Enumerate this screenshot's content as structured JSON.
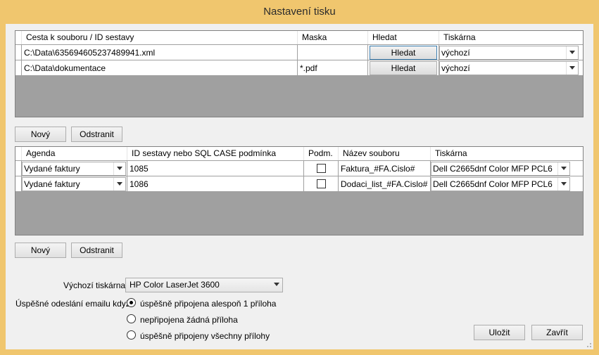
{
  "window": {
    "title": "Nastavení tisku"
  },
  "grid1": {
    "headers": [
      "Cesta k souboru / ID sestavy",
      "Maska",
      "Hledat",
      "Tiskárna"
    ],
    "rows": [
      {
        "path": "C:\\Data\\635694605237489941.xml",
        "mask": "",
        "button": "Hledat",
        "printer": "výchozí"
      },
      {
        "path": "C:\\Data\\dokumentace",
        "mask": "*.pdf",
        "button": "Hledat",
        "printer": "výchozí"
      }
    ]
  },
  "grid1_buttons": {
    "new": "Nový",
    "remove": "Odstranit"
  },
  "grid2": {
    "headers": [
      "Agenda",
      "ID sestavy nebo SQL CASE podmínka",
      "Podm.",
      "Název souboru",
      "Tiskárna"
    ],
    "rows": [
      {
        "agenda": "Vydané faktury",
        "id": "1085",
        "checked": false,
        "filename": "Faktura_#FA.Cislo#",
        "printer": "Dell C2665dnf Color MFP PCL6"
      },
      {
        "agenda": "Vydané faktury",
        "id": "1086",
        "checked": false,
        "filename": "Dodaci_list_#FA.Cislo#",
        "printer": "Dell C2665dnf Color MFP PCL6"
      }
    ]
  },
  "grid2_buttons": {
    "new": "Nový",
    "remove": "Odstranit"
  },
  "settings": {
    "default_printer_label": "Výchozí tiskárna:",
    "default_printer_value": "HP Color LaserJet 3600",
    "email_label": "Úspěšné odeslání emailu když:",
    "options": [
      {
        "label": "úspěšně připojena alespoň 1 příloha",
        "selected": true
      },
      {
        "label": "nepřipojena žádná příloha",
        "selected": false
      },
      {
        "label": "úspěšně připojeny všechny přílohy",
        "selected": false
      }
    ]
  },
  "footer": {
    "save": "Uložit",
    "close": "Zavřít"
  },
  "colors": {
    "frame": "#f0c66e",
    "client": "#f0f0f0",
    "grid_bg": "#a0a0a0"
  }
}
